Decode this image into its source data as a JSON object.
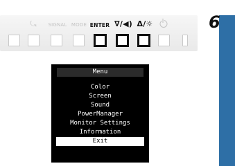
{
  "step_number": "6",
  "buttons": {
    "labels": {
      "input_icon": "⤿",
      "signal": "SIGNAL",
      "mode": "MODE",
      "enter": "ENTER",
      "down_volume": "∇/◀)",
      "up_brightness": "Δ/☼"
    },
    "active": [
      "enter",
      "down_volume",
      "up_brightness"
    ]
  },
  "osd": {
    "title": "Menu",
    "items": [
      {
        "label": "Color",
        "selected": false
      },
      {
        "label": "Screen",
        "selected": false
      },
      {
        "label": "Sound",
        "selected": false
      },
      {
        "label": "PowerManager",
        "selected": false
      },
      {
        "label": "Monitor Settings",
        "selected": false
      },
      {
        "label": "Information",
        "selected": false
      },
      {
        "label": "Exit",
        "selected": true
      }
    ]
  },
  "colors": {
    "panel_accent": "#2e6fa6",
    "osd_background": "#000000",
    "osd_title_bar": "#2b2b2b"
  }
}
